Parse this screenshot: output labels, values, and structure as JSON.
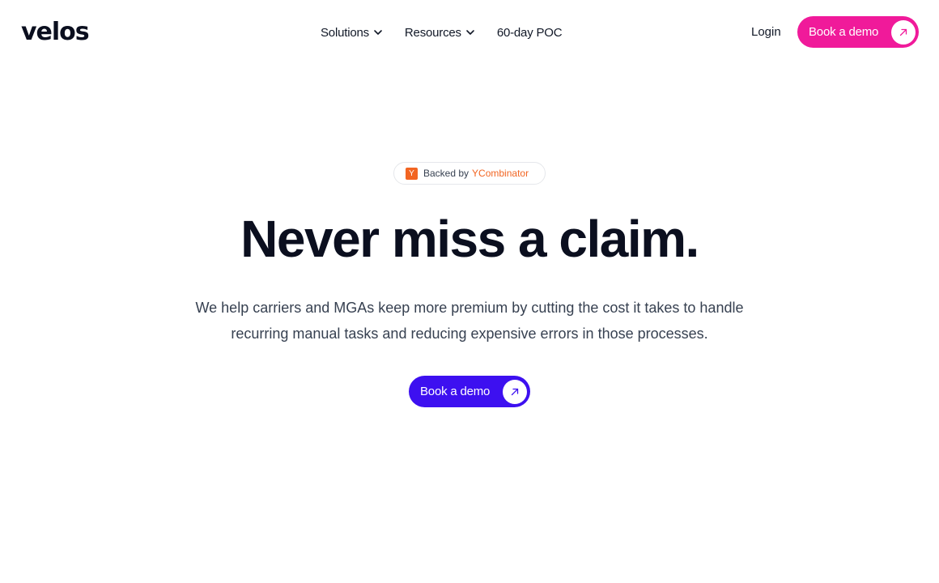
{
  "brand": {
    "logo_text": "velos"
  },
  "nav": {
    "items": [
      {
        "label": "Solutions",
        "has_dropdown": true
      },
      {
        "label": "Resources",
        "has_dropdown": true
      },
      {
        "label": "60-day POC",
        "has_dropdown": false
      }
    ],
    "login_label": "Login",
    "cta_label": "Book a demo"
  },
  "hero": {
    "badge": {
      "prefix": "Backed by",
      "name": "YCombinator",
      "icon_letter": "Y"
    },
    "headline": "Never miss a claim.",
    "subtext": "We help carriers and MGAs keep more premium by cutting the cost it takes to handle recurring manual tasks and reducing expensive errors in those processes.",
    "cta_label": "Book a demo"
  },
  "colors": {
    "header_cta": "#f01a9a",
    "hero_cta": "#3d10f0",
    "yc_orange": "#f26522",
    "text_dark": "#0b0f1f"
  },
  "icons": {
    "chevron": "chevron-down-icon",
    "arrow": "arrow-up-right-icon"
  }
}
